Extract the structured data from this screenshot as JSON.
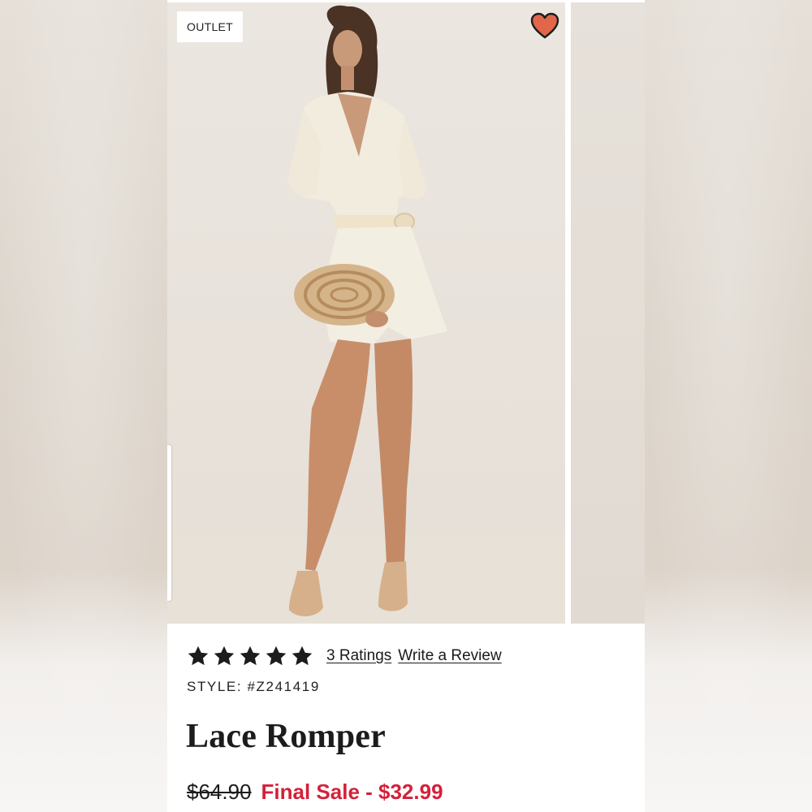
{
  "product": {
    "badge": "OUTLET",
    "ratings": {
      "stars": 5,
      "count_label": "3 Ratings",
      "write_review_label": "Write a Review"
    },
    "style_label": "STYLE: #Z241419",
    "title": "Lace Romper",
    "original_price": "$64.90",
    "sale_label": "Final Sale - $32.99"
  },
  "icons": {
    "heart": "heart-icon",
    "star": "star-icon"
  },
  "colors": {
    "sale_red": "#d3213a",
    "heart_fill": "#e2664a",
    "text_dark": "#1c1c1c"
  }
}
